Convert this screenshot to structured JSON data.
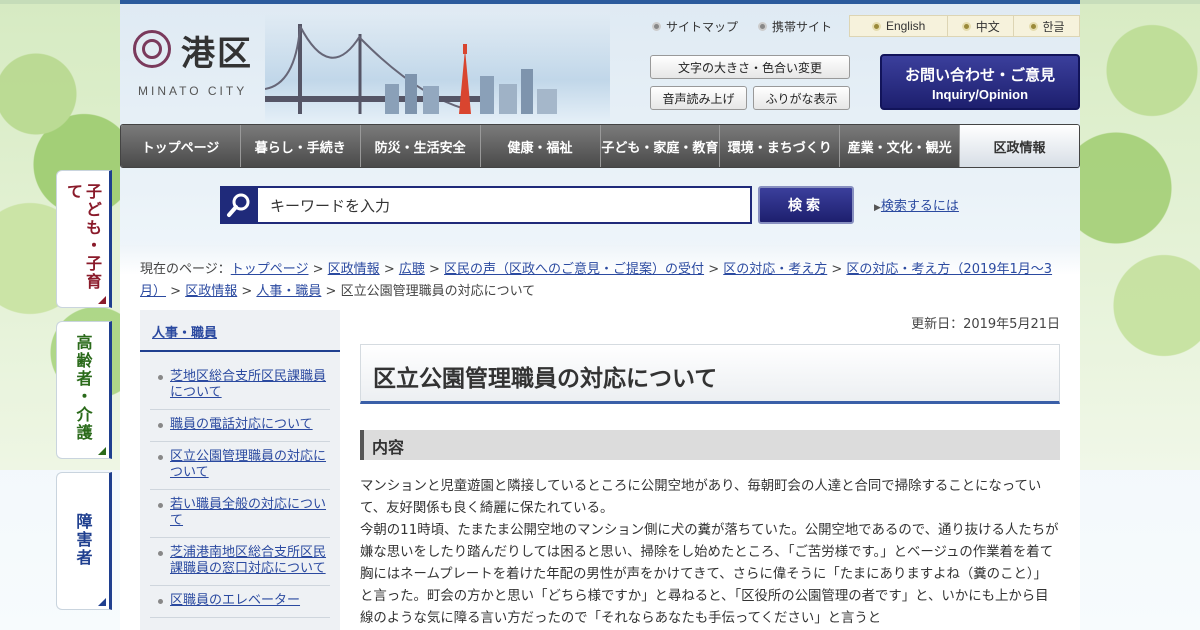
{
  "header": {
    "logo_text": "港区",
    "logo_sub": "MINATO CITY",
    "util_links": [
      "サイトマップ",
      "携帯サイト"
    ],
    "languages": [
      "English",
      "中文",
      "한글"
    ],
    "font_size_color": "文字の大きさ・色合い変更",
    "read_aloud": "音声読み上げ",
    "furigana": "ふりがな表示",
    "inquiry_line1": "お問い合わせ・ご意見",
    "inquiry_line2": "Inquiry/Opinion"
  },
  "gnav": [
    "トップページ",
    "暮らし・手続き",
    "防災・生活安全",
    "健康・福祉",
    "子ども・家庭・教育",
    "環境・まちづくり",
    "産業・文化・観光",
    "区政情報"
  ],
  "sidetabs": [
    {
      "label": "子ども・子育て",
      "color": "#8a1a2a"
    },
    {
      "label": "高齢者・介護",
      "color": "#2a6a1a"
    },
    {
      "label": "障害者",
      "color": "#1f3f8f"
    }
  ],
  "search": {
    "value": "キーワードを入力",
    "button": "検索",
    "help": "検索するには"
  },
  "breadcrumb": {
    "prefix": "現在のページ：",
    "links": [
      "トップページ",
      "区政情報",
      "広聴",
      "区民の声（区政へのご意見・ご提案）の受付",
      "区の対応・考え方",
      "区の対応・考え方（2019年1月～3月）",
      "区政情報",
      "人事・職員"
    ],
    "current": "区立公園管理職員の対応について"
  },
  "local_nav": {
    "heading": "人事・職員",
    "items": [
      "芝地区総合支所区民課職員について",
      "職員の電話対応について",
      "区立公園管理職員の対応について",
      "若い職員全般の対応について",
      "芝浦港南地区総合支所区民課職員の窓口対応について",
      "区職員のエレベーター"
    ]
  },
  "main": {
    "updated": "更新日：2019年5月21日",
    "title": "区立公園管理職員の対応について",
    "section": "内容",
    "paragraphs": [
      "マンションと児童遊園と隣接しているところに公開空地があり、毎朝町会の人達と合同で掃除することになっていて、友好関係も良く綺麗に保たれている。",
      "今朝の11時頃、たまたま公開空地のマンション側に犬の糞が落ちていた。公開空地であるので、通り抜ける人たちが嫌な思いをしたり踏んだりしては困ると思い、掃除をし始めたところ、「ご苦労様です。」とベージュの作業着を着て胸にはネームプレートを着けた年配の男性が声をかけてきて、さらに偉そうに「たまにありますよね（糞のこと）」と言った。町会の方かと思い「どちら様ですか」と尋ねると、「区役所の公園管理の者です」と、いかにも上から目線のような気に障る言い方だったので「それならあなたも手伝ってください」と言うと"
    ]
  }
}
